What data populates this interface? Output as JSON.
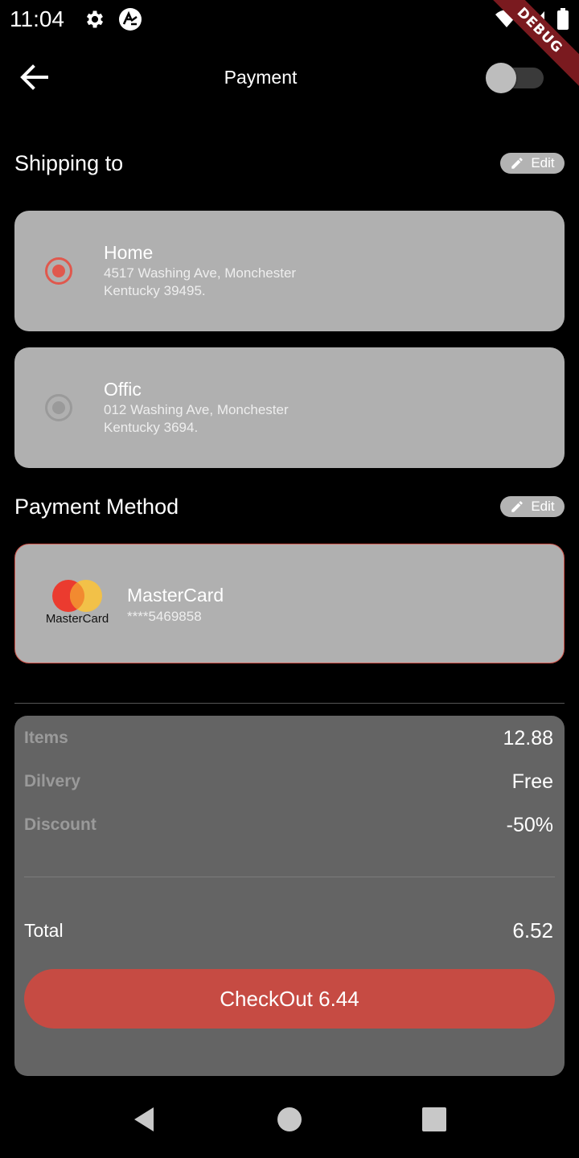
{
  "status_bar": {
    "time": "11:04",
    "icons": [
      "gear-icon",
      "app-notification-icon",
      "wifi-icon",
      "signal-icon",
      "battery-icon"
    ],
    "debug_label": "DEBUG"
  },
  "app_bar": {
    "title": "Payment",
    "back_icon": "arrow-left-icon",
    "toggle_on": false
  },
  "shipping": {
    "title": "Shipping to",
    "edit_label": "Edit",
    "addresses": [
      {
        "name": "Home",
        "line1": "4517 Washing Ave, Monchester",
        "line2": "Kentucky 39495.",
        "selected": true
      },
      {
        "name": "Offic",
        "line1": "012 Washing Ave, Monchester",
        "line2": "Kentucky 3694.",
        "selected": false
      }
    ]
  },
  "payment": {
    "title": "Payment Method",
    "edit_label": "Edit",
    "card": {
      "brand_caption": "MasterCard",
      "name": "MasterCard",
      "number": "****5469858"
    }
  },
  "summary": {
    "rows": [
      {
        "label": "Items",
        "value": "12.88"
      },
      {
        "label": "Dilvery",
        "value": "Free"
      },
      {
        "label": "Discount",
        "value": "-50%"
      }
    ],
    "total_label": "Total",
    "total_value": "6.52",
    "checkout_label": "CheckOut 6.44"
  },
  "colors": {
    "accent": "#c64b43",
    "radio_selected": "#e0584d",
    "card_bg": "#b0b0b0",
    "summary_bg": "#646464",
    "background": "#000000"
  },
  "nav_bar": {
    "icons": [
      "back-triangle-icon",
      "home-circle-icon",
      "recents-square-icon"
    ]
  }
}
